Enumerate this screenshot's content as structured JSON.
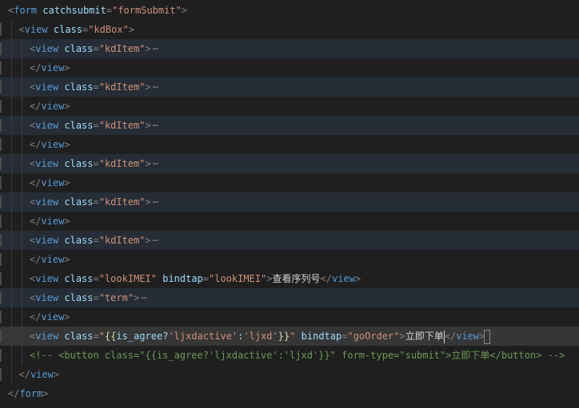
{
  "editor": {
    "lines": [
      {
        "indent": 0,
        "tokens": [
          [
            "punc",
            "<"
          ],
          [
            "tag",
            "form"
          ],
          [
            "text",
            " "
          ],
          [
            "attr",
            "catchsubmit"
          ],
          [
            "punc",
            "="
          ],
          [
            "str",
            "\"formSubmit\""
          ],
          [
            "punc",
            ">"
          ]
        ]
      },
      {
        "indent": 1,
        "tokens": [
          [
            "punc",
            "<"
          ],
          [
            "tag",
            "view"
          ],
          [
            "text",
            " "
          ],
          [
            "attr",
            "class"
          ],
          [
            "punc",
            "="
          ],
          [
            "str",
            "\"kdBox\""
          ],
          [
            "punc",
            ">"
          ]
        ]
      },
      {
        "indent": 2,
        "hl": true,
        "tokens": [
          [
            "punc",
            "<"
          ],
          [
            "tag",
            "view"
          ],
          [
            "text",
            " "
          ],
          [
            "attr",
            "class"
          ],
          [
            "punc",
            "="
          ],
          [
            "str",
            "\"kdItem\""
          ],
          [
            "punc",
            ">"
          ],
          [
            "fold",
            "⋯"
          ]
        ]
      },
      {
        "indent": 2,
        "tokens": [
          [
            "punc",
            "</"
          ],
          [
            "tag",
            "view"
          ],
          [
            "punc",
            ">"
          ]
        ]
      },
      {
        "indent": 2,
        "hl": true,
        "tokens": [
          [
            "punc",
            "<"
          ],
          [
            "tag",
            "view"
          ],
          [
            "text",
            " "
          ],
          [
            "attr",
            "class"
          ],
          [
            "punc",
            "="
          ],
          [
            "str",
            "\"kdItem\""
          ],
          [
            "punc",
            ">"
          ],
          [
            "fold",
            "⋯"
          ]
        ]
      },
      {
        "indent": 2,
        "tokens": [
          [
            "punc",
            "</"
          ],
          [
            "tag",
            "view"
          ],
          [
            "punc",
            ">"
          ]
        ]
      },
      {
        "indent": 2,
        "hl": true,
        "tokens": [
          [
            "punc",
            "<"
          ],
          [
            "tag",
            "view"
          ],
          [
            "text",
            " "
          ],
          [
            "attr",
            "class"
          ],
          [
            "punc",
            "="
          ],
          [
            "str",
            "\"kdItem\""
          ],
          [
            "punc",
            ">"
          ],
          [
            "fold",
            "⋯"
          ]
        ]
      },
      {
        "indent": 2,
        "tokens": [
          [
            "punc",
            "</"
          ],
          [
            "tag",
            "view"
          ],
          [
            "punc",
            ">"
          ]
        ]
      },
      {
        "indent": 2,
        "hl": true,
        "tokens": [
          [
            "punc",
            "<"
          ],
          [
            "tag",
            "view"
          ],
          [
            "text",
            " "
          ],
          [
            "attr",
            "class"
          ],
          [
            "punc",
            "="
          ],
          [
            "str",
            "\"kdItem\""
          ],
          [
            "punc",
            ">"
          ],
          [
            "fold",
            "⋯"
          ]
        ]
      },
      {
        "indent": 2,
        "tokens": [
          [
            "punc",
            "</"
          ],
          [
            "tag",
            "view"
          ],
          [
            "punc",
            ">"
          ]
        ]
      },
      {
        "indent": 2,
        "hl": true,
        "tokens": [
          [
            "punc",
            "<"
          ],
          [
            "tag",
            "view"
          ],
          [
            "text",
            " "
          ],
          [
            "attr",
            "class"
          ],
          [
            "punc",
            "="
          ],
          [
            "str",
            "\"kdItem\""
          ],
          [
            "punc",
            ">"
          ],
          [
            "fold",
            "⋯"
          ]
        ]
      },
      {
        "indent": 2,
        "tokens": [
          [
            "punc",
            "</"
          ],
          [
            "tag",
            "view"
          ],
          [
            "punc",
            ">"
          ]
        ]
      },
      {
        "indent": 2,
        "hl": true,
        "tokens": [
          [
            "punc",
            "<"
          ],
          [
            "tag",
            "view"
          ],
          [
            "text",
            " "
          ],
          [
            "attr",
            "class"
          ],
          [
            "punc",
            "="
          ],
          [
            "str",
            "\"kdItem\""
          ],
          [
            "punc",
            ">"
          ],
          [
            "fold",
            "⋯"
          ]
        ]
      },
      {
        "indent": 2,
        "tokens": [
          [
            "punc",
            "</"
          ],
          [
            "tag",
            "view"
          ],
          [
            "punc",
            ">"
          ]
        ]
      },
      {
        "indent": 2,
        "tokens": [
          [
            "punc",
            "<"
          ],
          [
            "tag",
            "view"
          ],
          [
            "text",
            " "
          ],
          [
            "attr",
            "class"
          ],
          [
            "punc",
            "="
          ],
          [
            "str",
            "\"lookIMEI\""
          ],
          [
            "text",
            " "
          ],
          [
            "attr",
            "bindtap"
          ],
          [
            "punc",
            "="
          ],
          [
            "str",
            "\"lookIMEI\""
          ],
          [
            "punc",
            ">"
          ],
          [
            "text",
            "查看序列号"
          ],
          [
            "punc",
            "</"
          ],
          [
            "tag",
            "view"
          ],
          [
            "punc",
            ">"
          ]
        ]
      },
      {
        "indent": 2,
        "hl": true,
        "tokens": [
          [
            "punc",
            "<"
          ],
          [
            "tag",
            "view"
          ],
          [
            "text",
            " "
          ],
          [
            "attr",
            "class"
          ],
          [
            "punc",
            "="
          ],
          [
            "str",
            "\"term\""
          ],
          [
            "punc",
            ">"
          ],
          [
            "fold",
            "⋯"
          ]
        ]
      },
      {
        "indent": 2,
        "tokens": [
          [
            "punc",
            "</"
          ],
          [
            "tag",
            "view"
          ],
          [
            "punc",
            ">"
          ]
        ]
      },
      {
        "indent": 2,
        "cur": true,
        "tokens": [
          [
            "punc",
            "<"
          ],
          [
            "tag",
            "view"
          ],
          [
            "text",
            " "
          ],
          [
            "attr",
            "class"
          ],
          [
            "punc",
            "="
          ],
          [
            "str",
            "\""
          ],
          [
            "brace",
            "{{"
          ],
          [
            "attr",
            "is_agree?"
          ],
          [
            "str",
            "'ljxdactive'"
          ],
          [
            "attr",
            ":"
          ],
          [
            "str",
            "'ljxd'"
          ],
          [
            "brace",
            "}}"
          ],
          [
            "str",
            "\""
          ],
          [
            "text",
            " "
          ],
          [
            "attr",
            "bindtap"
          ],
          [
            "punc",
            "="
          ],
          [
            "str",
            "\"goOrder\""
          ],
          [
            "punc",
            ">"
          ],
          [
            "text",
            "立即下单"
          ],
          [
            "cursor",
            ""
          ],
          [
            "punc",
            "</"
          ],
          [
            "tag",
            "view"
          ],
          [
            "punc",
            ">"
          ],
          [
            "box",
            ""
          ]
        ]
      },
      {
        "indent": 2,
        "tokens": [
          [
            "comment",
            "<!-- <button class=\"{{is_agree?'ljxdactive':'ljxd'}}\" form-type=\"submit\">立即下单</button> -->"
          ]
        ]
      },
      {
        "indent": 1,
        "tokens": [
          [
            "punc",
            "</"
          ],
          [
            "tag",
            "view"
          ],
          [
            "punc",
            ">"
          ]
        ]
      },
      {
        "indent": 0,
        "tokens": [
          [
            "punc",
            "</"
          ],
          [
            "tag",
            "form"
          ],
          [
            "punc",
            ">"
          ]
        ]
      }
    ]
  }
}
